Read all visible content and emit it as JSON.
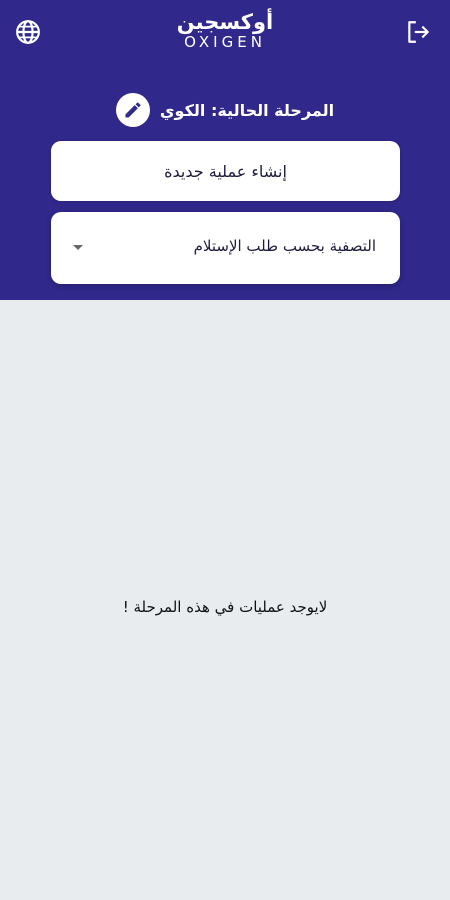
{
  "app": {
    "logo_ar": "أوكسجين",
    "logo_en": "OXIGEN"
  },
  "icons": {
    "language": "globe-icon",
    "logout": "logout-icon",
    "edit": "pencil-icon",
    "dropdown": "caret-down-icon"
  },
  "stage": {
    "label": "المرحلة الحالية: الكوي"
  },
  "actions": {
    "create_label": "إنشاء عملية جديدة"
  },
  "filter": {
    "selected": "التصفية بحسب طلب الإستلام"
  },
  "empty_state": {
    "message": "لايوجد عمليات في هذه المرحلة !"
  },
  "colors": {
    "header": "#30288a",
    "background": "#e9ecef",
    "card": "#ffffff"
  }
}
